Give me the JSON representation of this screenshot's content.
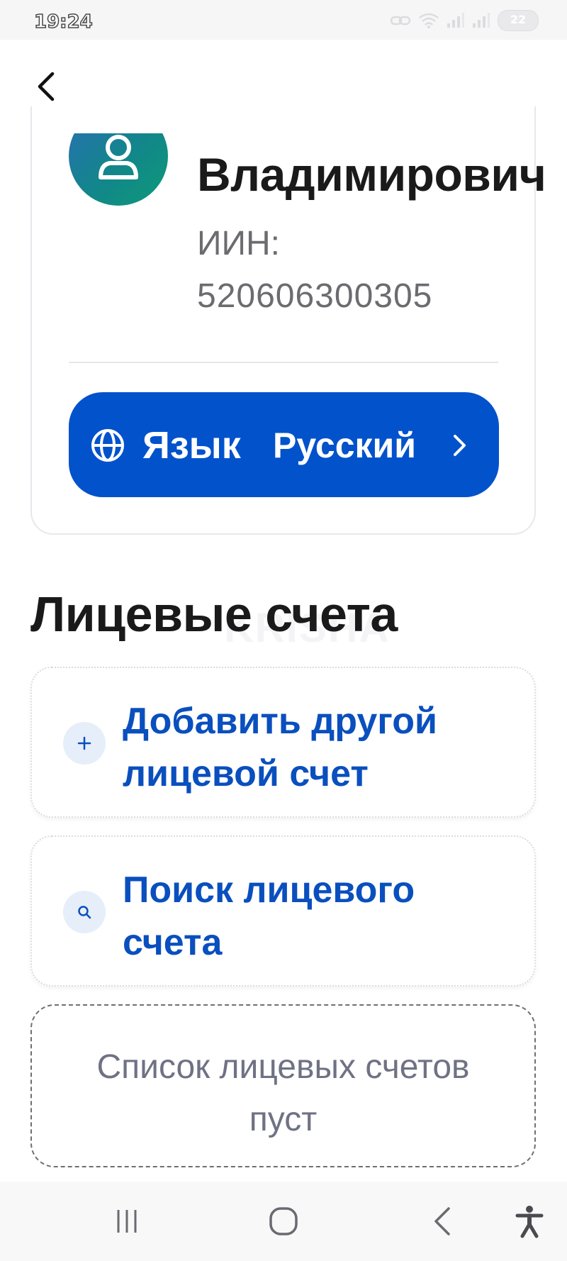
{
  "status_bar": {
    "time": "19:24",
    "battery": "22"
  },
  "header": {
    "back_icon": "chevron-left-icon"
  },
  "profile": {
    "name": "Владимирович",
    "iin_label": "ИИН:",
    "iin_value": "520606300305",
    "avatar_icon": "user-icon"
  },
  "language": {
    "label": "Язык",
    "value": "Русский",
    "icon": "globe-icon"
  },
  "accounts": {
    "title": "Лицевые счета",
    "watermark": "KRISHA",
    "add_label": "Добавить другой лицевой счет",
    "search_label": "Поиск лицевого счета",
    "empty_text": "Список лицевых счетов пуст"
  },
  "colors": {
    "primary": "#0252cc",
    "link": "#0a4fbe",
    "muted_text": "#6b6b70",
    "icon_bg": "#e6eef9"
  },
  "nav": {
    "icons": [
      "recent-apps-icon",
      "home-icon",
      "back-icon",
      "accessibility-icon"
    ]
  }
}
